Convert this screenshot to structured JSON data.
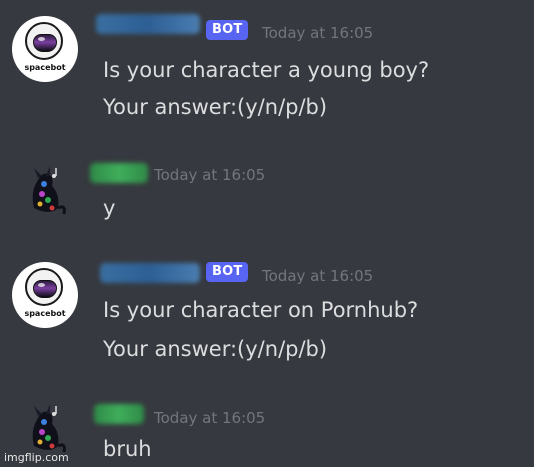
{
  "messages": [
    {
      "author": "spacebot",
      "badge": "BOT",
      "timestamp": "Today at 16:05",
      "lines": [
        "Is your character a young boy?",
        "Your answer:(y/n/p/b)"
      ]
    },
    {
      "timestamp": "Today at 16:05",
      "lines": [
        "y"
      ]
    },
    {
      "author": "spacebot",
      "badge": "BOT",
      "timestamp": "Today at 16:05",
      "lines": [
        "Is your character on Pornhub?",
        "Your answer:(y/n/p/b)"
      ]
    },
    {
      "timestamp": "Today at 16:05",
      "lines": [
        "bruh"
      ]
    }
  ],
  "colors": {
    "background": "#36393f",
    "bot_badge": "#5865f2",
    "timestamp": "#72767d",
    "message_text": "#dcddde"
  },
  "watermark": "imgflip.com"
}
